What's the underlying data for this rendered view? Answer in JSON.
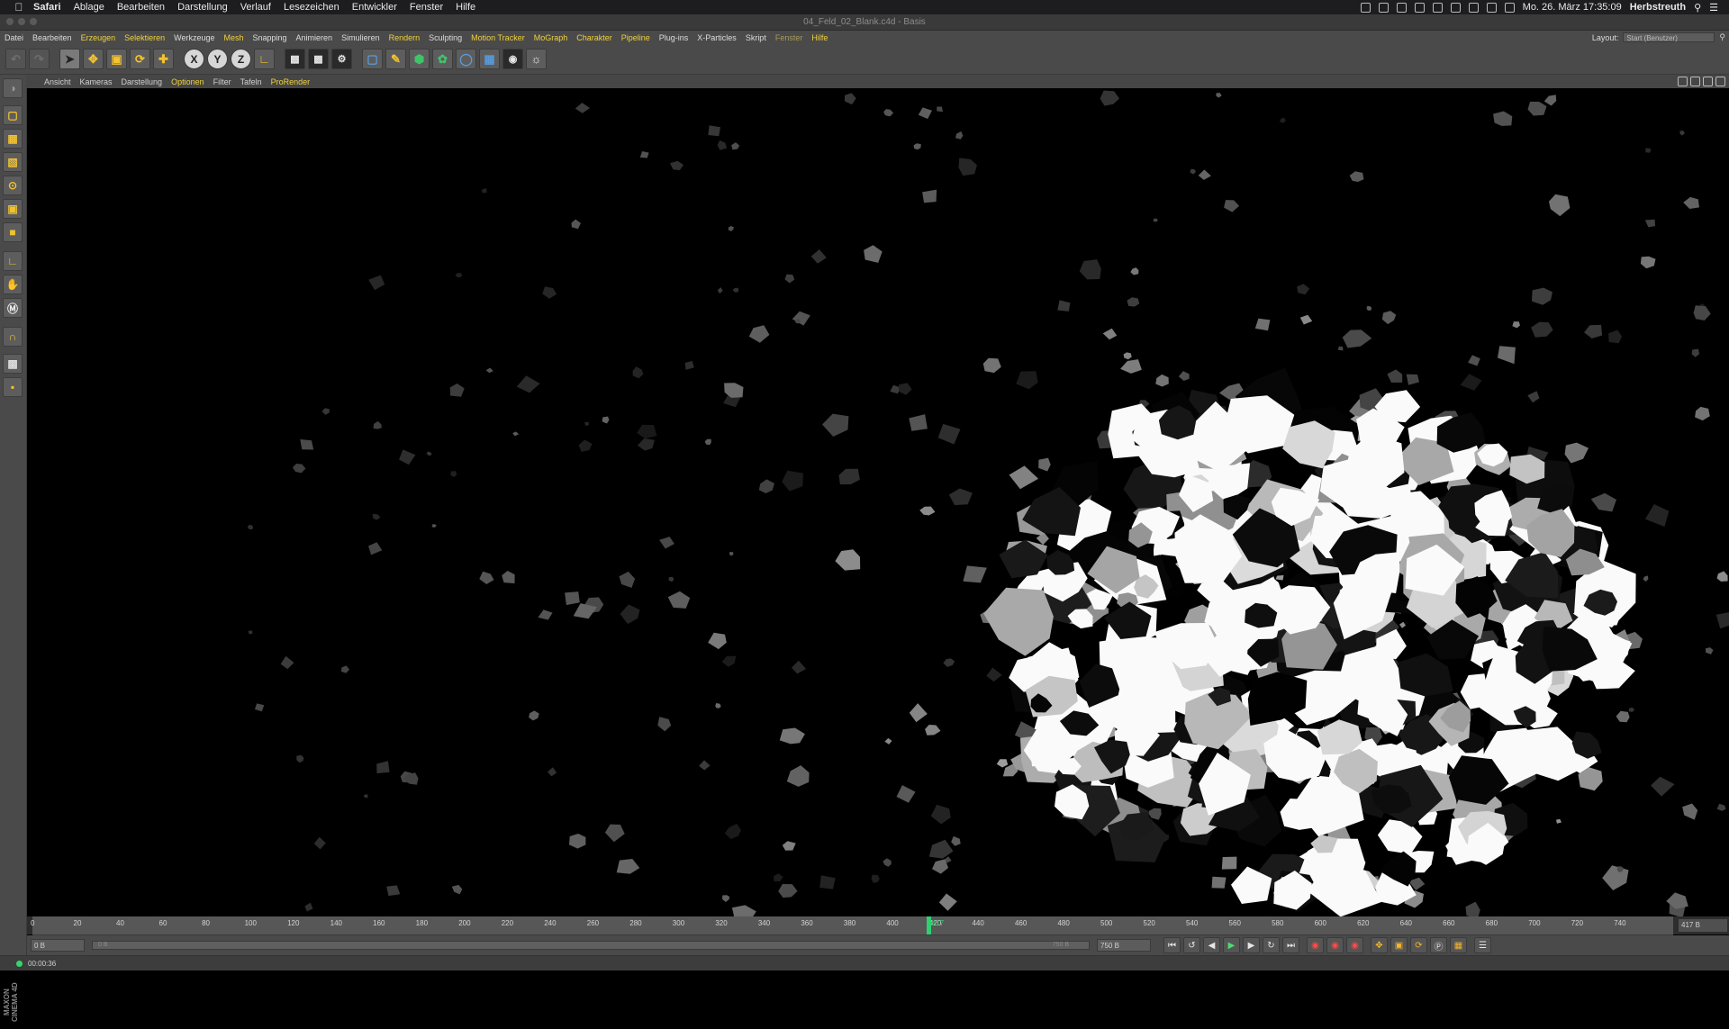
{
  "menubar": {
    "app": "Safari",
    "items": [
      "Ablage",
      "Bearbeiten",
      "Darstellung",
      "Verlauf",
      "Lesezeichen",
      "Entwickler",
      "Fenster",
      "Hilfe"
    ],
    "clock": "Mo. 26. März  17:35:09",
    "user": "Herbstreuth"
  },
  "window": {
    "title": "04_Feld_02_Blank.c4d - Basis"
  },
  "c4d_menu": {
    "items": [
      {
        "label": "Datei",
        "style": "normal"
      },
      {
        "label": "Bearbeiten",
        "style": "normal"
      },
      {
        "label": "Erzeugen",
        "style": "hl"
      },
      {
        "label": "Selektieren",
        "style": "hl"
      },
      {
        "label": "Werkzeuge",
        "style": "normal"
      },
      {
        "label": "Mesh",
        "style": "hl"
      },
      {
        "label": "Snapping",
        "style": "normal"
      },
      {
        "label": "Animieren",
        "style": "normal"
      },
      {
        "label": "Simulieren",
        "style": "normal"
      },
      {
        "label": "Rendern",
        "style": "hl"
      },
      {
        "label": "Sculpting",
        "style": "normal"
      },
      {
        "label": "Motion Tracker",
        "style": "hl"
      },
      {
        "label": "MoGraph",
        "style": "hl"
      },
      {
        "label": "Charakter",
        "style": "hl"
      },
      {
        "label": "Pipeline",
        "style": "hl"
      },
      {
        "label": "Plug-ins",
        "style": "normal"
      },
      {
        "label": "X-Particles",
        "style": "normal"
      },
      {
        "label": "Skript",
        "style": "normal"
      },
      {
        "label": "Fenster",
        "style": "dim"
      },
      {
        "label": "Hilfe",
        "style": "hl"
      }
    ],
    "layout_label": "Layout:",
    "layout_value": "Start (Benutzer)"
  },
  "toolbar": {
    "axis_x": "X",
    "axis_y": "Y",
    "axis_z": "Z"
  },
  "viewport_menu": {
    "items": [
      {
        "label": "Ansicht",
        "style": "normal"
      },
      {
        "label": "Kameras",
        "style": "normal"
      },
      {
        "label": "Darstellung",
        "style": "normal"
      },
      {
        "label": "Optionen",
        "style": "hl"
      },
      {
        "label": "Filter",
        "style": "normal"
      },
      {
        "label": "Tafeln",
        "style": "normal"
      },
      {
        "label": "ProRender",
        "style": "hl"
      }
    ]
  },
  "timeline": {
    "ticks": [
      "0",
      "20",
      "40",
      "60",
      "80",
      "100",
      "120",
      "140",
      "160",
      "180",
      "200",
      "220",
      "240",
      "260",
      "280",
      "300",
      "320",
      "340",
      "360",
      "380",
      "400",
      "420",
      "440",
      "460",
      "480",
      "500",
      "520",
      "540",
      "560",
      "580",
      "600",
      "620",
      "640",
      "660",
      "680",
      "700",
      "720",
      "740"
    ],
    "current_frame": 417,
    "current_frame_label": "417",
    "current_frame_field": "417 B",
    "frame_max": 750
  },
  "controls": {
    "start": "0 B",
    "range_left": "0 B",
    "range_right": "750 B",
    "end": "750 B"
  },
  "status": {
    "time": "00:00:36"
  },
  "brand": {
    "logo_text": "MAXON CINEMA 4D"
  },
  "colors": {
    "accent_yellow": "#f0d13c",
    "playhead_green": "#2fd06f",
    "viewport_bg": "#000000"
  }
}
